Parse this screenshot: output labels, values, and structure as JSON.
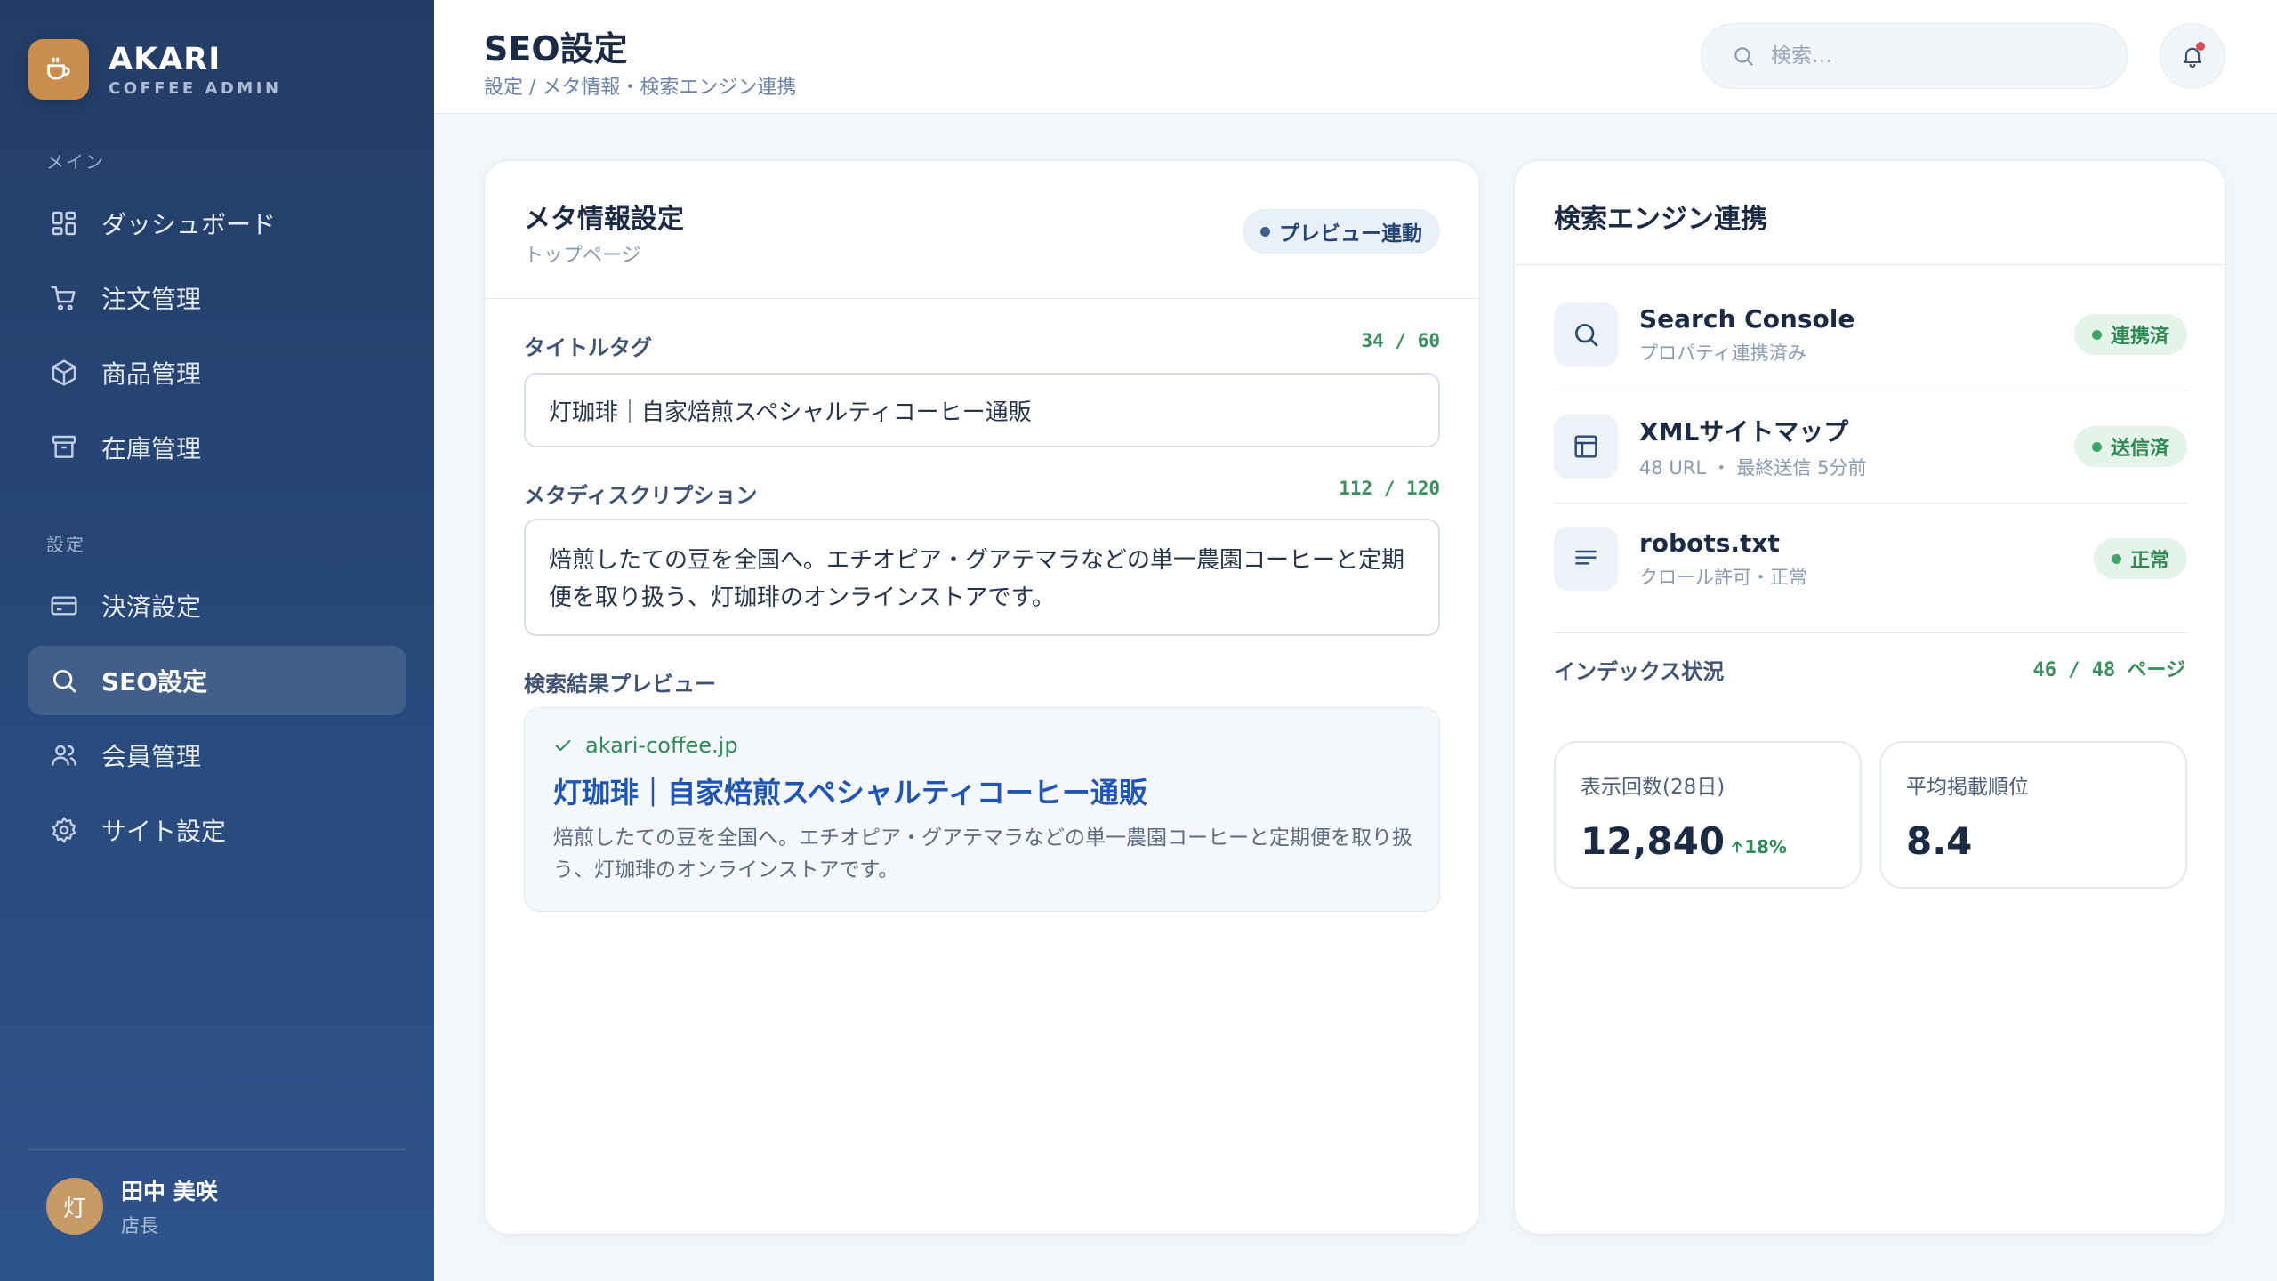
{
  "brand": {
    "name": "AKARI",
    "subtitle": "COFFEE ADMIN",
    "icon": "coffee-cup-icon"
  },
  "sidebar": {
    "sections": [
      {
        "label": "メイン",
        "items": [
          {
            "label": "ダッシュボード",
            "icon": "dashboard-grid-icon"
          },
          {
            "label": "注文管理",
            "icon": "cart-icon"
          },
          {
            "label": "商品管理",
            "icon": "box-icon"
          },
          {
            "label": "在庫管理",
            "icon": "archive-icon"
          }
        ]
      },
      {
        "label": "設定",
        "items": [
          {
            "label": "決済設定",
            "icon": "credit-card-icon"
          },
          {
            "label": "SEO設定",
            "icon": "search-icon",
            "active": true
          },
          {
            "label": "会員管理",
            "icon": "users-icon"
          },
          {
            "label": "サイト設定",
            "icon": "gear-icon"
          }
        ]
      }
    ],
    "user": {
      "avatar_initial": "灯",
      "name": "田中 美咲",
      "role": "店長"
    }
  },
  "header": {
    "title": "SEO設定",
    "breadcrumb": "設定 / メタ情報・検索エンジン連携",
    "search_placeholder": "検索…",
    "notification_icon": "bell-icon"
  },
  "meta_card": {
    "title": "メタ情報設定",
    "subtitle": "トップページ",
    "badge": "プレビュー連動",
    "title_tag": {
      "label": "タイトルタグ",
      "counter": "34 / 60",
      "value": "灯珈琲｜自家焙煎スペシャルティコーヒー通販"
    },
    "description": {
      "label": "メタディスクリプション",
      "counter": "112 / 120",
      "value": "焙煎したての豆を全国へ。エチオピア・グアテマラなどの単一農園コーヒーと定期便を取り扱う、灯珈琲のオンラインストアです。"
    },
    "preview": {
      "label": "検索結果プレビュー",
      "url": "akari-coffee.jp",
      "title": "灯珈琲｜自家焙煎スペシャルティコーヒー通販",
      "description": "焙煎したての豆を全国へ。エチオピア・グアテマラなどの単一農園コーヒーと定期便を取り扱う、灯珈琲のオンラインストアです。"
    }
  },
  "engine_card": {
    "title": "検索エンジン連携",
    "items": [
      {
        "name": "Search Console",
        "detail": "プロパティ連携済み",
        "status": "連携済",
        "icon": "search-icon"
      },
      {
        "name": "XMLサイトマップ",
        "detail": "48 URL ・ 最終送信 5分前",
        "status": "送信済",
        "icon": "sitemap-layout-icon"
      },
      {
        "name": "robots.txt",
        "detail": "クロール許可・正常",
        "status": "正常",
        "icon": "text-lines-icon"
      }
    ],
    "index_label": "インデックス状況",
    "index_value": "46 / 48 ページ",
    "stats": [
      {
        "label": "表示回数(28日)",
        "value": "12,840",
        "trend": "18%"
      },
      {
        "label": "平均掲載順位",
        "value": "8.4"
      }
    ]
  },
  "colors": {
    "sidebar": "#233d66",
    "accent_green": "#2f8a56",
    "link_blue": "#1f55b8",
    "brand_orange": "#c98e4e"
  }
}
